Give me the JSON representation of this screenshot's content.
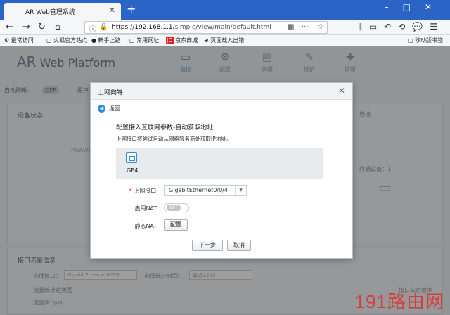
{
  "browser": {
    "tab_title": "AR Web管理系统",
    "url_host": "https://192.168.1.1",
    "url_path": "/simple/view/main/default.html",
    "bookmarks": [
      "最常访问",
      "火狐官方站点",
      "新手上路",
      "常用网址",
      "京东商城",
      "页面载入出错"
    ],
    "mobile_bookmarks": "移动版书签"
  },
  "app": {
    "logo_ar": "AR",
    "logo_rest": " Web Platform",
    "nav": [
      {
        "label": "监控",
        "icon": "monitor-icon"
      },
      {
        "label": "配置",
        "icon": "gear-icon"
      },
      {
        "label": "高级",
        "icon": "advanced-icon"
      },
      {
        "label": "维护",
        "icon": "wrench-icon"
      },
      {
        "label": "诊断",
        "icon": "diagnose-icon"
      }
    ],
    "auto_refresh_label": "自动刷新：",
    "auto_refresh_state": "OFF",
    "user_label": "用户",
    "device_status_title": "设备状态",
    "device_name": "HUAWEI",
    "connection_title": "连接",
    "terminal_label": "终端设备：1",
    "traffic_title": "接口流量信息",
    "select_port_label": "选择接口：",
    "select_port_value": "GigabitEthernet0/0/0",
    "select_time_label": "选择统计时间：",
    "select_time_value": "最近1小时",
    "trend_title": "流量统计趋势图",
    "traffic_unit": "流量(Kbps)",
    "realtime_label": "接口实时速率"
  },
  "dialog": {
    "title": "上网向导",
    "back": "返回",
    "heading": "配置接入互联网参数-自动获取地址",
    "desc": "上网接口将尝试自动从网络服务商处获取IP地址。",
    "port": "GE4",
    "wan_label": "上网接口:",
    "wan_value": "GigabitEthernet0/0/4",
    "nat_label": "启用NAT:",
    "nat_state": "OFF",
    "static_nat_label": "静态NAT:",
    "config_button": "配置",
    "next_button": "下一步",
    "cancel_button": "取消"
  },
  "watermark": "191路由网"
}
